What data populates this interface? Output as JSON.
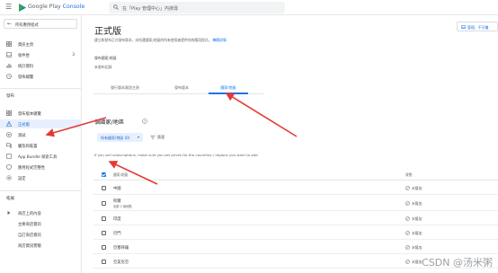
{
  "header": {
    "brand_prefix": "Google Play ",
    "brand_suffix": "Console",
    "search_placeholder": "在「Play 管理中心」內搜尋"
  },
  "sidebar": {
    "back_label": "所有應用程式",
    "items_top": [
      {
        "label": "資訊主頁",
        "count": ""
      },
      {
        "label": "收件匣",
        "count": "3"
      },
      {
        "label": "統計資料",
        "count": ""
      },
      {
        "label": "發佈總覽",
        "count": ""
      }
    ],
    "release_header": "發布",
    "items_release": [
      {
        "label": "發布版本總覽",
        "active": false
      },
      {
        "label": "正式版",
        "active": true
      },
      {
        "label": "測試",
        "active": false
      },
      {
        "label": "觸及和裝置",
        "active": false
      },
      {
        "label": "App Bundle 探索工具",
        "active": false
      },
      {
        "label": "應用程式完整性",
        "active": false
      },
      {
        "label": "設定",
        "active": false
      }
    ],
    "grow_header": "拓展",
    "items_grow": [
      {
        "label": "商店上的內容"
      },
      {
        "label": "主要商店資訊"
      },
      {
        "label": "自訂商店資訊"
      },
      {
        "label": "商店資訊實驗"
      }
    ]
  },
  "main": {
    "title": "正式版",
    "description": "建立和發布正式發布版本，向所選國家/地區的所有使用者提供你的應用程式。",
    "description_link": "瞭解詳情",
    "toolbar_button": "管理，不可繼",
    "meta_label": "發布國家/地區",
    "meta_value": "未發布記錄",
    "tabs": [
      "發行版本資訊主頁",
      "發布版本",
      "國家/地區"
    ],
    "active_tab": 2,
    "section_title": "個國家/地區",
    "filter_chip": "所有國家/地區 (0)",
    "filter_label": "篩選",
    "note": "If you sell subscriptions, make sure you set prices for the countries / regions you want to add",
    "table_headers": {
      "name": "國家/地區",
      "status": "狀態"
    },
    "rows": [
      {
        "name": "中國",
        "note": "",
        "status": "未獲加"
      },
      {
        "name": "阿爾",
        "note": "全部 2 個地點",
        "status": "未獲加"
      },
      {
        "name": "印度",
        "note": "",
        "status": "未獲加"
      },
      {
        "name": "巴門",
        "note": "",
        "status": "未獲加"
      },
      {
        "name": "亞塞拜疆",
        "note": "",
        "status": "未獲加"
      },
      {
        "name": "亞美尼亞",
        "note": "",
        "status": "未獲加"
      },
      {
        "name": "以色列",
        "note": "",
        "status": "未獲加"
      }
    ]
  },
  "watermark": "CSDN @汤米粥",
  "colors": {
    "accent": "#1a73e8",
    "arrow": "#e53935"
  }
}
